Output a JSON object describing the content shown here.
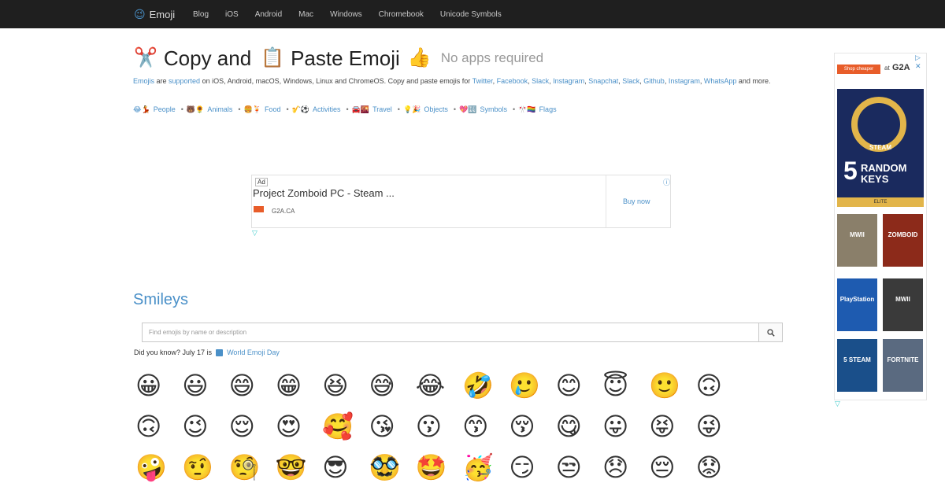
{
  "nav": {
    "brand_icon": "😉",
    "brand_label": "Emoji",
    "links": [
      "Blog",
      "iOS",
      "Android",
      "Mac",
      "Windows",
      "Chromebook",
      "Unicode Symbols"
    ]
  },
  "header": {
    "emoji1": "✂️",
    "part1": "Copy and",
    "emoji2": "📋",
    "part2": "Paste Emoji",
    "emoji3": "👍",
    "subtitle": "No apps required"
  },
  "intro": {
    "emojis_link": "Emojis",
    "are": " are ",
    "supported_link": "supported",
    "text1": " on iOS, Android, macOS, Windows, Linux and ChromeOS. Copy and paste emojis for ",
    "platforms": [
      "Twitter",
      "Facebook",
      "Slack",
      "Instagram",
      "Snapchat",
      "Slack",
      "Github",
      "Instagram",
      "WhatsApp"
    ],
    "and_more": " and more."
  },
  "categories": [
    {
      "emojis": "😂💃",
      "label": "People"
    },
    {
      "emojis": "🐻🌻",
      "label": "Animals"
    },
    {
      "emojis": "🍔🍹",
      "label": "Food"
    },
    {
      "emojis": "🎷⚽",
      "label": "Activities"
    },
    {
      "emojis": "🚘🌇",
      "label": "Travel"
    },
    {
      "emojis": "💡🎉",
      "label": "Objects"
    },
    {
      "emojis": "💖🔣",
      "label": "Symbols"
    },
    {
      "emojis": "🎌🏳️‍🌈",
      "label": "Flags"
    }
  ],
  "ad": {
    "badge": "Ad",
    "title": "Project Zomboid PC - Steam ...",
    "domain": "G2A.CA",
    "cta": "Buy now",
    "info": "ⓘ",
    "choice": "▽"
  },
  "smileys": {
    "title": "Smileys",
    "search_placeholder": "Find emojis by name or description",
    "did_you_know": "Did you know? July 17 is",
    "world_emoji_day": "World Emoji Day",
    "rows": [
      [
        "😀",
        "😃",
        "😄",
        "😁",
        "😆",
        "😅",
        "😂",
        "🤣",
        "🥲",
        "😊",
        "😇",
        "🙂",
        "🙃"
      ],
      [
        "🙃",
        "😉",
        "😌",
        "😍",
        "🥰",
        "😘",
        "😗",
        "😙",
        "😚",
        "😋",
        "😛",
        "😝",
        "😜"
      ],
      [
        "🤪",
        "🤨",
        "🧐",
        "🤓",
        "😎",
        "🥸",
        "🤩",
        "🥳",
        "😏",
        "😒",
        "😞",
        "😔",
        "😟"
      ]
    ]
  },
  "sidebar_ad": {
    "shop": "Shop cheaper",
    "at": "at",
    "brand": "G2A",
    "close": "▷ ✕",
    "steam": "STEAM",
    "number": "5",
    "keys": "RANDOM KEYS",
    "elite": "ELITE",
    "tiles": [
      "MWII",
      "ZOMBOID",
      "PlayStation",
      "MWII",
      "5 STEAM",
      "FORTNITE"
    ],
    "choice": "▽"
  },
  "colors": {
    "navbar_bg": "#1f1f1f",
    "link": "#4a90c8",
    "g2a_orange": "#e85d2a"
  }
}
